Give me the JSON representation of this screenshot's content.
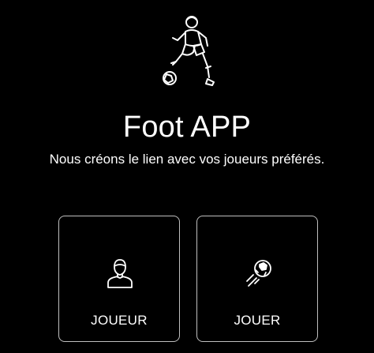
{
  "app": {
    "title": "Foot APP",
    "subtitle": "Nous créons le lien avec vos joueurs préférés."
  },
  "hero": {
    "icon": "footballer-icon"
  },
  "cards": [
    {
      "label": "JOUEUR",
      "icon": "player-avatar-icon"
    },
    {
      "label": "JOUER",
      "icon": "kicked-ball-icon"
    }
  ],
  "colors": {
    "background": "#000000",
    "text": "#ffffff",
    "card_border": "#bfbfbf"
  }
}
